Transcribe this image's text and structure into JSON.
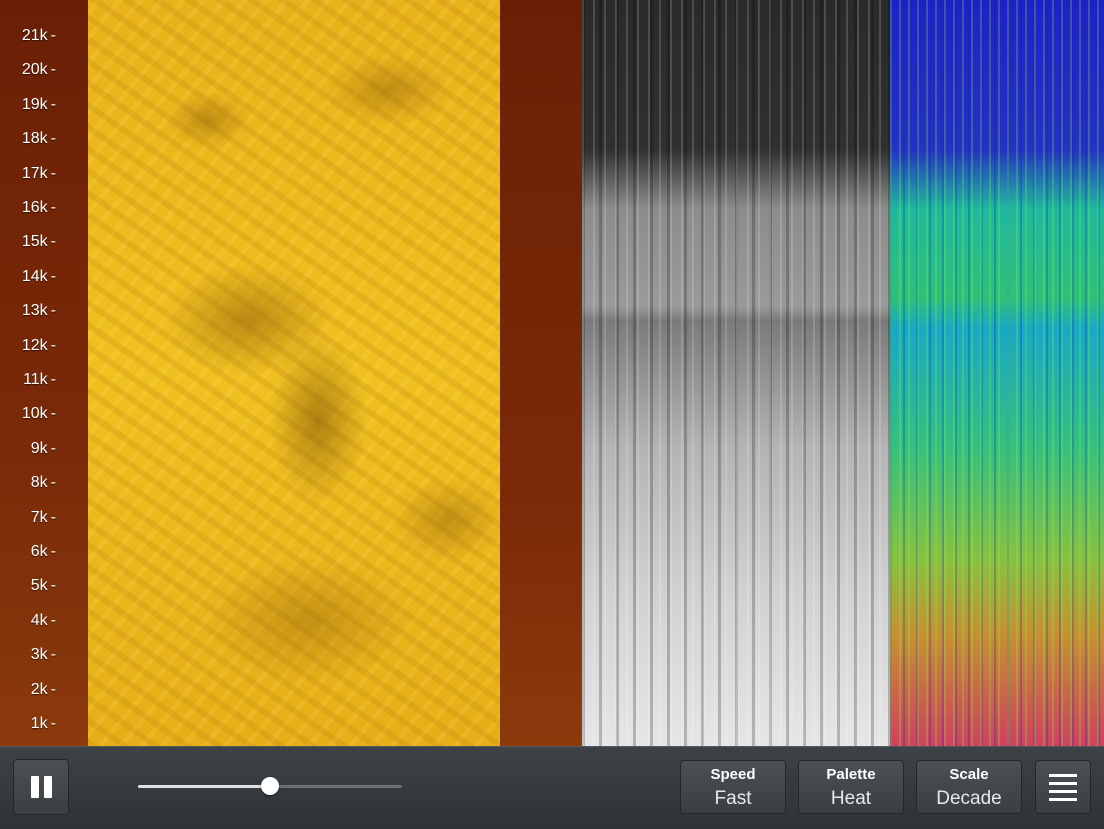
{
  "frequency_axis": {
    "ticks": [
      "21k",
      "20k",
      "19k",
      "18k",
      "17k",
      "16k",
      "15k",
      "14k",
      "13k",
      "12k",
      "11k",
      "10k",
      "9k",
      "8k",
      "7k",
      "6k",
      "5k",
      "4k",
      "3k",
      "2k",
      "1k"
    ],
    "tick_mark": "-"
  },
  "toolbar": {
    "pause_icon": "pause-icon",
    "slider": {
      "value_fraction": 0.5
    },
    "speed": {
      "label": "Speed",
      "value": "Fast"
    },
    "palette": {
      "label": "Palette",
      "value": "Heat"
    },
    "scale": {
      "label": "Scale",
      "value": "Decade"
    },
    "menu_icon": "menu-icon"
  },
  "colors": {
    "rust": "#6e2206",
    "yellow_band": "#f0c020",
    "toolbar_bg": "#33383b",
    "slider_fill": "#e0e0e0"
  }
}
